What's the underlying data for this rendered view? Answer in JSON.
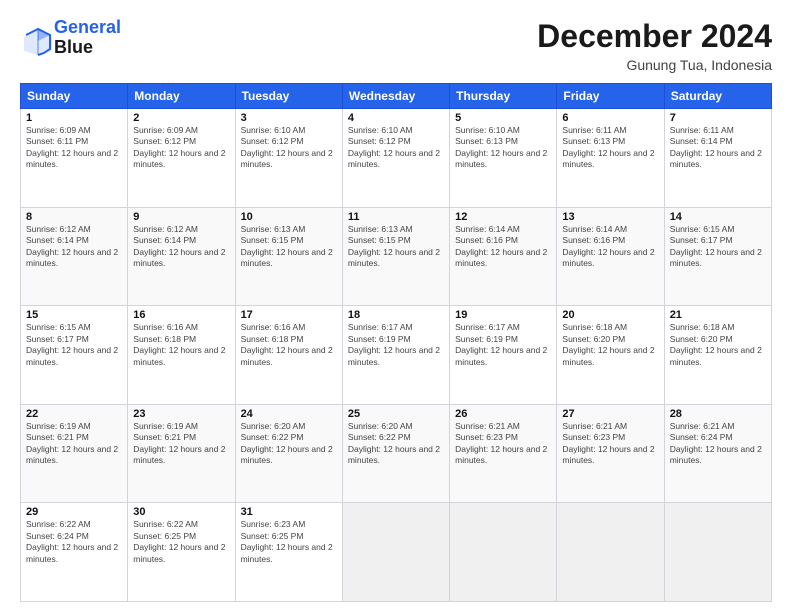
{
  "header": {
    "logo_line1": "General",
    "logo_line2": "Blue",
    "month": "December 2024",
    "location": "Gunung Tua, Indonesia"
  },
  "weekdays": [
    "Sunday",
    "Monday",
    "Tuesday",
    "Wednesday",
    "Thursday",
    "Friday",
    "Saturday"
  ],
  "weeks": [
    [
      {
        "day": "1",
        "sunrise": "6:09 AM",
        "sunset": "6:11 PM",
        "daylight": "12 hours and 2 minutes."
      },
      {
        "day": "2",
        "sunrise": "6:09 AM",
        "sunset": "6:12 PM",
        "daylight": "12 hours and 2 minutes."
      },
      {
        "day": "3",
        "sunrise": "6:10 AM",
        "sunset": "6:12 PM",
        "daylight": "12 hours and 2 minutes."
      },
      {
        "day": "4",
        "sunrise": "6:10 AM",
        "sunset": "6:12 PM",
        "daylight": "12 hours and 2 minutes."
      },
      {
        "day": "5",
        "sunrise": "6:10 AM",
        "sunset": "6:13 PM",
        "daylight": "12 hours and 2 minutes."
      },
      {
        "day": "6",
        "sunrise": "6:11 AM",
        "sunset": "6:13 PM",
        "daylight": "12 hours and 2 minutes."
      },
      {
        "day": "7",
        "sunrise": "6:11 AM",
        "sunset": "6:14 PM",
        "daylight": "12 hours and 2 minutes."
      }
    ],
    [
      {
        "day": "8",
        "sunrise": "6:12 AM",
        "sunset": "6:14 PM",
        "daylight": "12 hours and 2 minutes."
      },
      {
        "day": "9",
        "sunrise": "6:12 AM",
        "sunset": "6:14 PM",
        "daylight": "12 hours and 2 minutes."
      },
      {
        "day": "10",
        "sunrise": "6:13 AM",
        "sunset": "6:15 PM",
        "daylight": "12 hours and 2 minutes."
      },
      {
        "day": "11",
        "sunrise": "6:13 AM",
        "sunset": "6:15 PM",
        "daylight": "12 hours and 2 minutes."
      },
      {
        "day": "12",
        "sunrise": "6:14 AM",
        "sunset": "6:16 PM",
        "daylight": "12 hours and 2 minutes."
      },
      {
        "day": "13",
        "sunrise": "6:14 AM",
        "sunset": "6:16 PM",
        "daylight": "12 hours and 2 minutes."
      },
      {
        "day": "14",
        "sunrise": "6:15 AM",
        "sunset": "6:17 PM",
        "daylight": "12 hours and 2 minutes."
      }
    ],
    [
      {
        "day": "15",
        "sunrise": "6:15 AM",
        "sunset": "6:17 PM",
        "daylight": "12 hours and 2 minutes."
      },
      {
        "day": "16",
        "sunrise": "6:16 AM",
        "sunset": "6:18 PM",
        "daylight": "12 hours and 2 minutes."
      },
      {
        "day": "17",
        "sunrise": "6:16 AM",
        "sunset": "6:18 PM",
        "daylight": "12 hours and 2 minutes."
      },
      {
        "day": "18",
        "sunrise": "6:17 AM",
        "sunset": "6:19 PM",
        "daylight": "12 hours and 2 minutes."
      },
      {
        "day": "19",
        "sunrise": "6:17 AM",
        "sunset": "6:19 PM",
        "daylight": "12 hours and 2 minutes."
      },
      {
        "day": "20",
        "sunrise": "6:18 AM",
        "sunset": "6:20 PM",
        "daylight": "12 hours and 2 minutes."
      },
      {
        "day": "21",
        "sunrise": "6:18 AM",
        "sunset": "6:20 PM",
        "daylight": "12 hours and 2 minutes."
      }
    ],
    [
      {
        "day": "22",
        "sunrise": "6:19 AM",
        "sunset": "6:21 PM",
        "daylight": "12 hours and 2 minutes."
      },
      {
        "day": "23",
        "sunrise": "6:19 AM",
        "sunset": "6:21 PM",
        "daylight": "12 hours and 2 minutes."
      },
      {
        "day": "24",
        "sunrise": "6:20 AM",
        "sunset": "6:22 PM",
        "daylight": "12 hours and 2 minutes."
      },
      {
        "day": "25",
        "sunrise": "6:20 AM",
        "sunset": "6:22 PM",
        "daylight": "12 hours and 2 minutes."
      },
      {
        "day": "26",
        "sunrise": "6:21 AM",
        "sunset": "6:23 PM",
        "daylight": "12 hours and 2 minutes."
      },
      {
        "day": "27",
        "sunrise": "6:21 AM",
        "sunset": "6:23 PM",
        "daylight": "12 hours and 2 minutes."
      },
      {
        "day": "28",
        "sunrise": "6:21 AM",
        "sunset": "6:24 PM",
        "daylight": "12 hours and 2 minutes."
      }
    ],
    [
      {
        "day": "29",
        "sunrise": "6:22 AM",
        "sunset": "6:24 PM",
        "daylight": "12 hours and 2 minutes."
      },
      {
        "day": "30",
        "sunrise": "6:22 AM",
        "sunset": "6:25 PM",
        "daylight": "12 hours and 2 minutes."
      },
      {
        "day": "31",
        "sunrise": "6:23 AM",
        "sunset": "6:25 PM",
        "daylight": "12 hours and 2 minutes."
      },
      null,
      null,
      null,
      null
    ]
  ]
}
